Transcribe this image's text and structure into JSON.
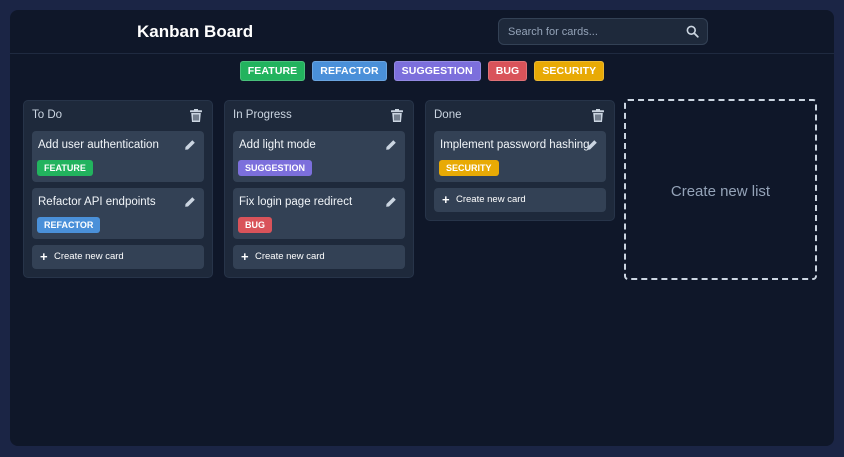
{
  "header": {
    "title": "Kanban Board",
    "search_placeholder": "Search for cards..."
  },
  "tags": [
    {
      "label": "FEATURE",
      "color": "#22b35e"
    },
    {
      "label": "REFACTOR",
      "color": "#4a90d9"
    },
    {
      "label": "SUGGESTION",
      "color": "#7c6fdc"
    },
    {
      "label": "BUG",
      "color": "#d9535a"
    },
    {
      "label": "SECURITY",
      "color": "#e8aa05"
    }
  ],
  "lists": [
    {
      "title": "To Do",
      "cards": [
        {
          "title": "Add user authentication",
          "tag": "FEATURE"
        },
        {
          "title": "Refactor API endpoints",
          "tag": "REFACTOR"
        }
      ],
      "create_card_label": "Create new card"
    },
    {
      "title": "In Progress",
      "cards": [
        {
          "title": "Add light mode",
          "tag": "SUGGESTION"
        },
        {
          "title": "Fix login page redirect",
          "tag": "BUG"
        }
      ],
      "create_card_label": "Create new card"
    },
    {
      "title": "Done",
      "cards": [
        {
          "title": "Implement password hashing",
          "tag": "SECURITY"
        }
      ],
      "create_card_label": "Create new card"
    }
  ],
  "create_list_label": "Create new list"
}
